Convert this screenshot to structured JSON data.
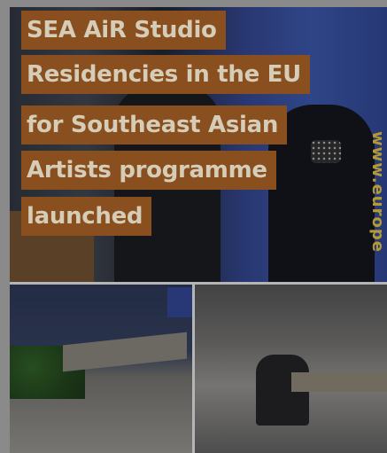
{
  "headline": {
    "lines": [
      "SEA AiR Studio",
      "Residencies in the EU",
      "for Southeast Asian",
      "Artists programme",
      "launched"
    ]
  },
  "photo_text": "www.europe",
  "colors": {
    "headline_bg": "#8a4f1f",
    "headline_text": "#d5cdb8",
    "frame": "#8a8a8a"
  }
}
